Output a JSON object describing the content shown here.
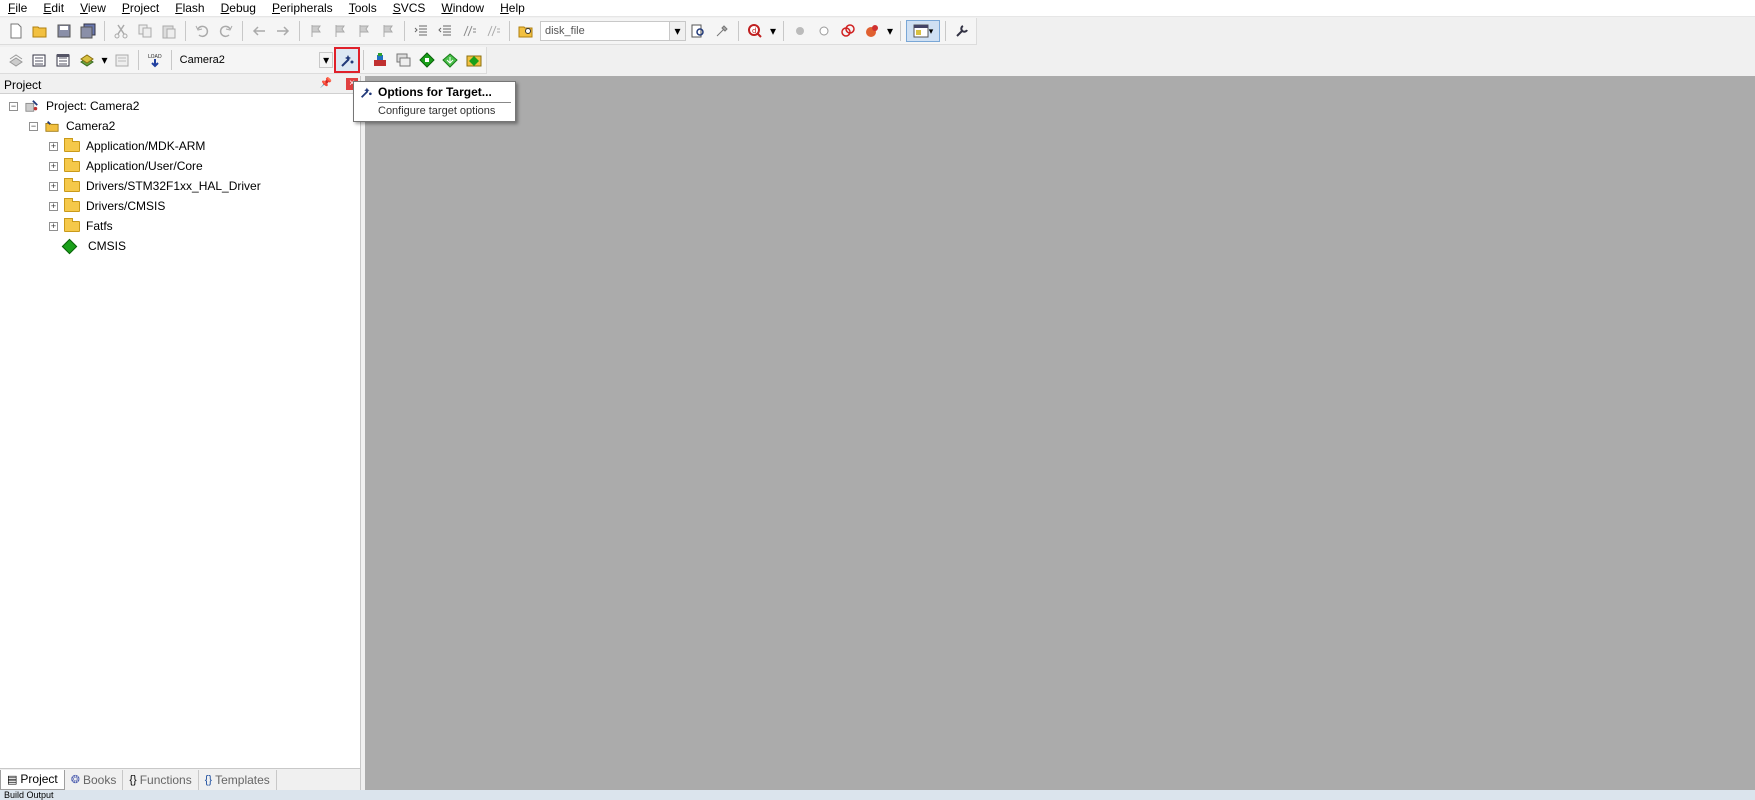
{
  "menu": [
    "File",
    "Edit",
    "View",
    "Project",
    "Flash",
    "Debug",
    "Peripherals",
    "Tools",
    "SVCS",
    "Window",
    "Help"
  ],
  "menu_mnemonics": [
    "F",
    "E",
    "V",
    "P",
    "F",
    "D",
    "P",
    "T",
    "S",
    "W",
    "H"
  ],
  "toolbar1": {
    "find_combo_value": "disk_file"
  },
  "toolbar2": {
    "load_label": "LOAD",
    "target_combo_value": "Camera2"
  },
  "project_panel": {
    "title": "Project",
    "root": "Project: Camera2",
    "target": "Camera2",
    "groups": [
      "Application/MDK-ARM",
      "Application/User/Core",
      "Drivers/STM32F1xx_HAL_Driver",
      "Drivers/CMSIS",
      "Fatfs"
    ],
    "component": "CMSIS"
  },
  "panel_tabs": [
    "Project",
    "Books",
    "Functions",
    "Templates"
  ],
  "tab_icons": [
    "▤",
    "❂",
    "{}",
    "{}"
  ],
  "tooltip": {
    "title": "Options for Target...",
    "description": "Configure target options"
  },
  "status_text": "Build Output",
  "colors": {
    "editor_background": "#ababab",
    "highlight_border": "#e0202a",
    "tree_component": "#1aa01a"
  }
}
